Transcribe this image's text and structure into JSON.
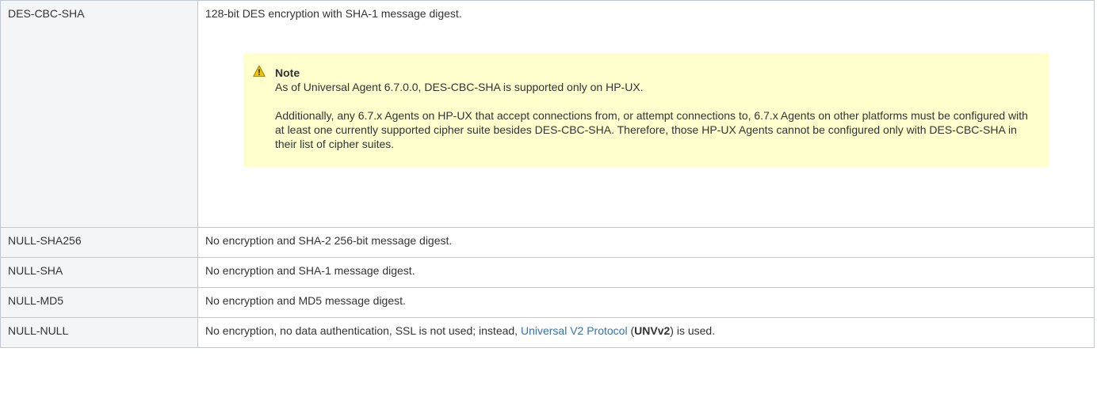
{
  "rows": [
    {
      "name": "DES-CBC-SHA",
      "description": "128-bit DES encryption with SHA-1 message digest.",
      "note": {
        "title": "Note",
        "line1": "As of Universal Agent 6.7.0.0, DES-CBC-SHA is supported only on HP-UX.",
        "line2": "Additionally, any 6.7.x Agents on HP-UX that accept connections from, or attempt connections to, 6.7.x Agents on other platforms must be configured with at least one currently supported cipher suite besides DES-CBC-SHA. Therefore, those HP-UX Agents cannot be configured only with DES-CBC-SHA in their list of cipher suites."
      }
    },
    {
      "name": "NULL-SHA256",
      "description": "No encryption and SHA-2 256-bit message digest."
    },
    {
      "name": "NULL-SHA",
      "description": "No encryption and SHA-1 message digest."
    },
    {
      "name": "NULL-MD5",
      "description": "No encryption and MD5 message digest."
    },
    {
      "name": "NULL-NULL",
      "description_prefix": "No encryption, no data authentication, SSL is not used; instead, ",
      "link_text": "Universal V2 Protocol",
      "paren_open": " (",
      "acronym": "UNVv2",
      "description_suffix": ") is used."
    }
  ],
  "icons": {
    "note": "warning-icon"
  },
  "colors": {
    "note_background": "#ffffce",
    "name_cell_background": "#f4f5f7",
    "border": "#c1c7d0",
    "link": "#3572b0",
    "warning_fill": "#f5c400"
  }
}
